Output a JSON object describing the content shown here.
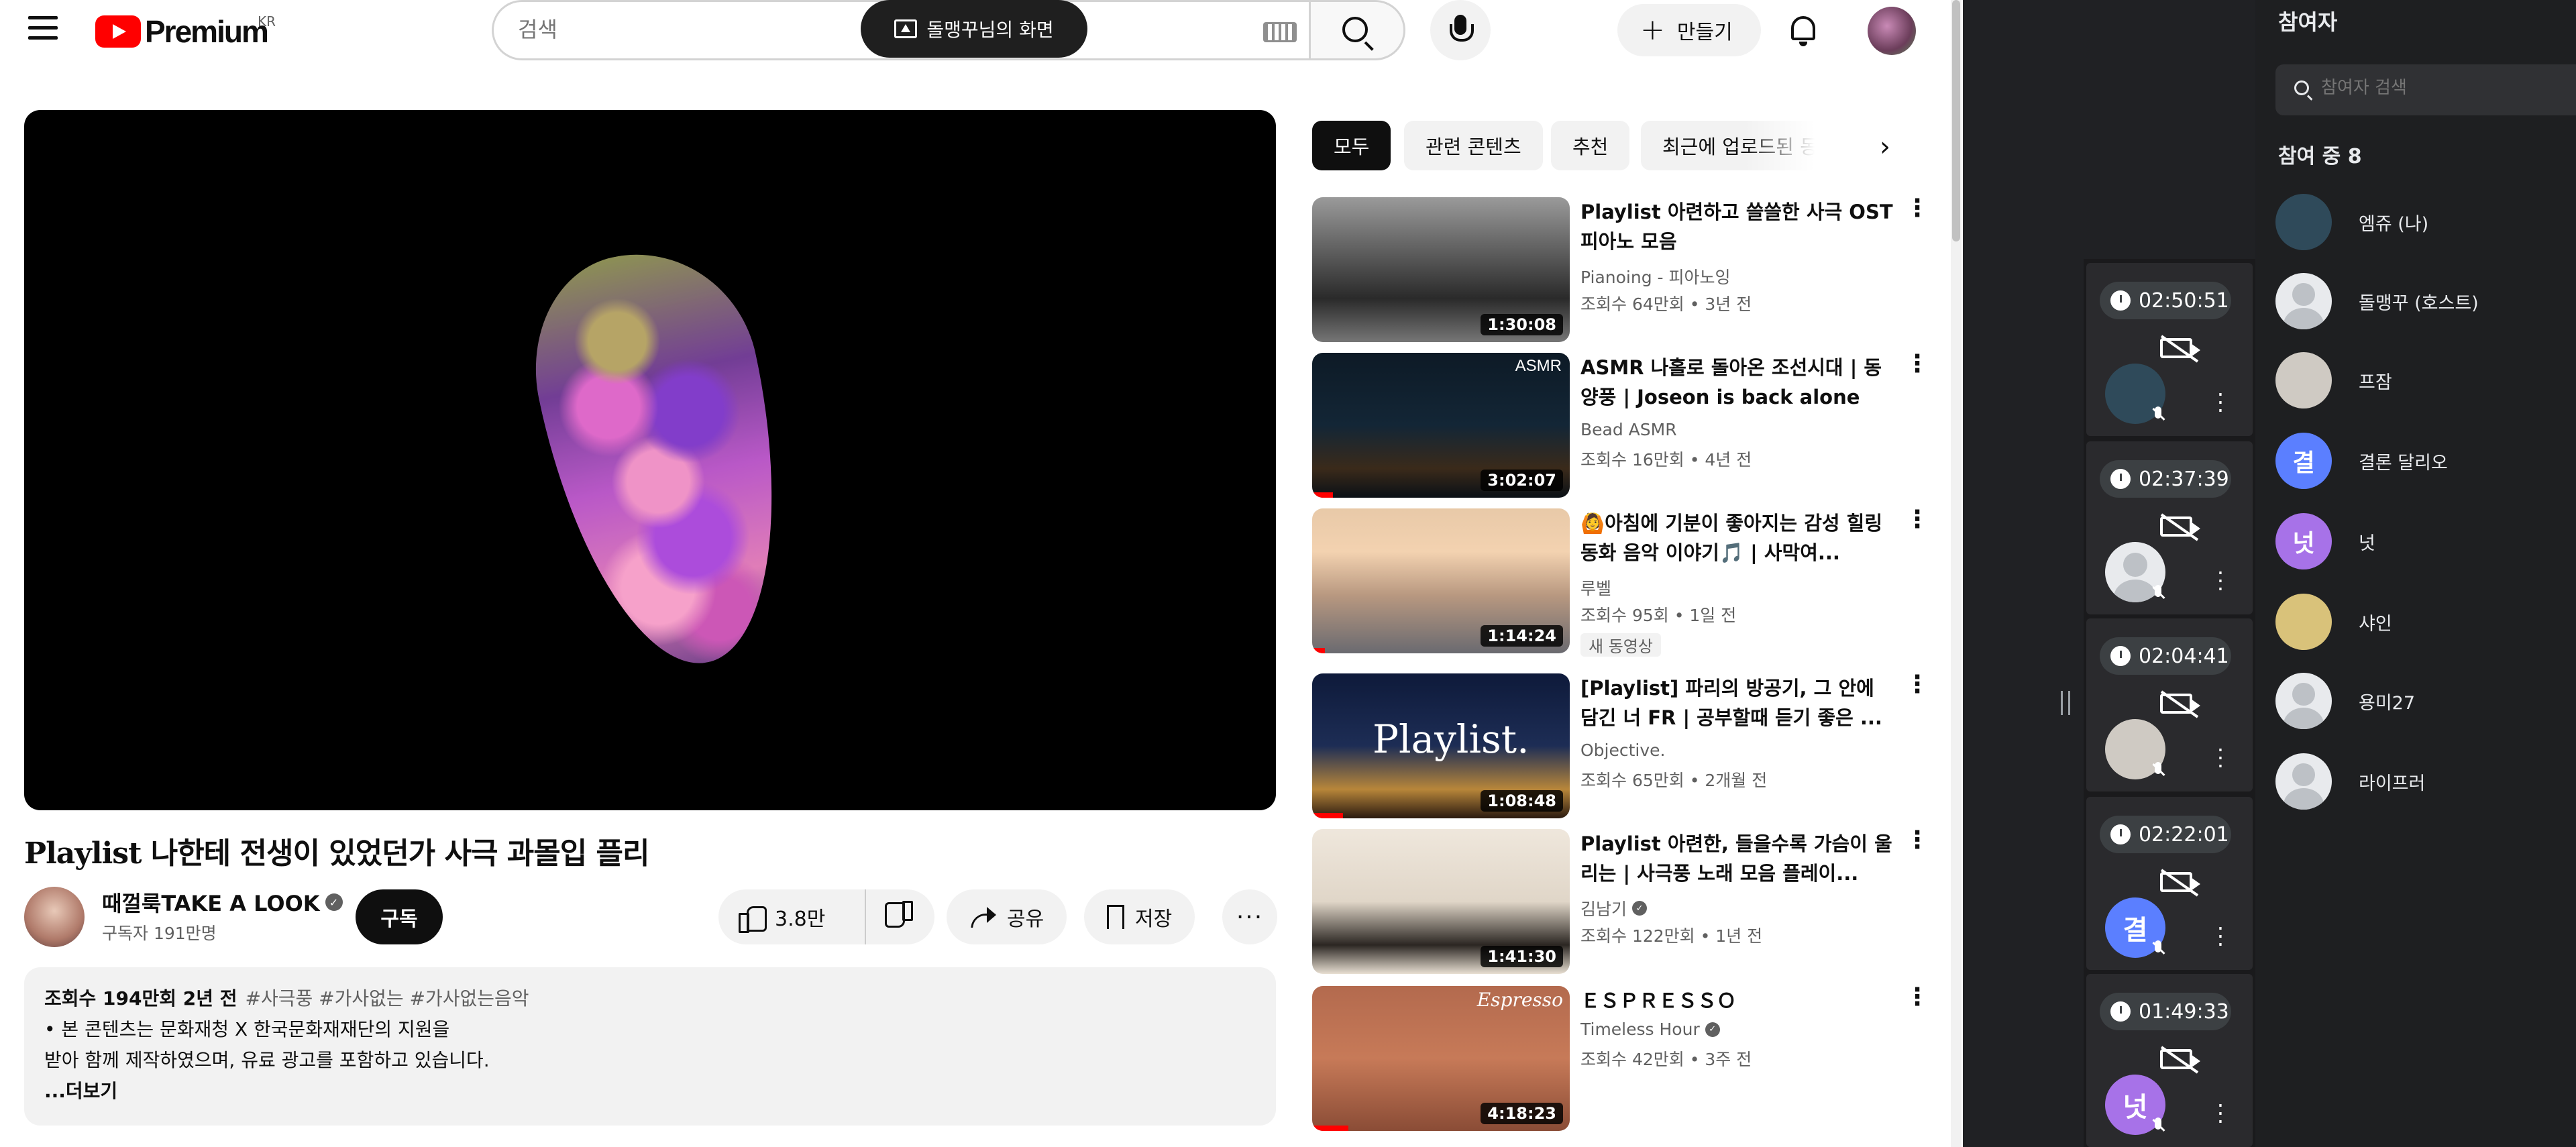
{
  "header": {
    "logo_text": "Premium",
    "logo_region": "KR",
    "search_placeholder": "검색",
    "screen_share_label": "돌맹꾸님의 화면",
    "create_label": "만들기"
  },
  "video": {
    "title": "Playlist 나한테 전생이 있었던가 사극 과몰입 플리",
    "channel": "때껄룩TAKE A LOOK",
    "subscribers": "구독자 191만명",
    "subscribe_label": "구독",
    "likes": "3.8만",
    "share_label": "공유",
    "save_label": "저장",
    "more_label": "···",
    "description": {
      "stats": "조회수 194만회  2년 전",
      "tags": "#사극풍 #가사없는 #가사없는음악",
      "line1": "• 본 콘텐츠는 문화재청 X 한국문화재재단의 지원을",
      "line2": "받아 함께 제작하였으며, 유료 광고를 포함하고 있습니다.",
      "more": "...더보기"
    }
  },
  "chips": [
    "모두",
    "관련 콘텐츠",
    "추천",
    "최근에 업로드된 동영상"
  ],
  "recommendations": [
    {
      "title": "Playlist 아련하고 쓸쓸한 사극 OST 피아노 모음",
      "channel": "Pianoing - 피아노잉",
      "views": "조회수 64만회 • 3년 전",
      "duration": "1:30:08",
      "verified": false,
      "badge": "",
      "progress": 0
    },
    {
      "title": "ASMR 나홀로 돌아온 조선시대 | 동양풍 | Joseon is back alone",
      "channel": "Bead ASMR",
      "views": "조회수 16만회 • 4년 전",
      "duration": "3:02:07",
      "verified": false,
      "badge": "",
      "progress": 0.08,
      "thumb_text": "ASMR"
    },
    {
      "title": "🙆아침에 기분이 좋아지는 감성 힐링 동화 음악 이야기🎵 | 사막여...",
      "channel": "루벨",
      "views": "조회수 95회 • 1일 전",
      "duration": "1:14:24",
      "verified": false,
      "badge": "새 동영상",
      "progress": 0.05
    },
    {
      "title": "[Playlist] 파리의 방공기, 그 안에 담긴 너 FR |  공부할때 듣기 좋은 ...",
      "channel": "Objective.",
      "views": "조회수 65만회 • 2개월 전",
      "duration": "1:08:48",
      "verified": false,
      "badge": "",
      "progress": 0.12,
      "thumb_text": "Playlist."
    },
    {
      "title": "Playlist 아련한, 들을수록 가슴이 울리는 | 사극풍 노래 모음 플레이...",
      "channel": "김남기",
      "views": "조회수 122만회 • 1년 전",
      "duration": "1:41:30",
      "verified": true,
      "badge": "",
      "progress": 0
    },
    {
      "title": "ＥＳＰＲＥＳＳＯ",
      "channel": "Timeless Hour",
      "views": "조회수 42만회 • 3주 전",
      "duration": "4:18:23",
      "verified": true,
      "badge": "",
      "progress": 0.14,
      "thumb_text": "Espresso"
    }
  ],
  "meet": {
    "panel_title": "참여자",
    "search_placeholder": "참여자 검색",
    "count_label": "참여 중 8",
    "tiles": [
      {
        "time": "02:50:51",
        "avatar_letter": "",
        "avatar_color": "#2f4a5a"
      },
      {
        "time": "02:37:39",
        "avatar_letter": "",
        "avatar_color": "#e8eaed"
      },
      {
        "time": "02:04:41",
        "avatar_letter": "",
        "avatar_color": "#cfcac3"
      },
      {
        "time": "02:22:01",
        "avatar_letter": "결",
        "avatar_color": "#5b7fff"
      },
      {
        "time": "01:49:33",
        "avatar_letter": "넛",
        "avatar_color": "#a772e8"
      }
    ],
    "participants": [
      {
        "name": "엠쥬 (나)",
        "letter": "",
        "color": "#2f4a5a"
      },
      {
        "name": "돌맹꾸 (호스트)",
        "letter": "",
        "color": "silhouette"
      },
      {
        "name": "프잠",
        "letter": "",
        "color": "#cfcac3"
      },
      {
        "name": "결론 달리오",
        "letter": "결",
        "color": "#5b7fff"
      },
      {
        "name": "넛",
        "letter": "넛",
        "color": "#a772e8"
      },
      {
        "name": "샤인",
        "letter": "",
        "color": "#d9c27a"
      },
      {
        "name": "용미27",
        "letter": "",
        "color": "silhouette"
      },
      {
        "name": "라이프러",
        "letter": "",
        "color": "silhouette"
      }
    ]
  },
  "colors": {
    "accent": "#ff0000",
    "dark_bg": "#202124",
    "chip_active": "#0f0f0f"
  }
}
